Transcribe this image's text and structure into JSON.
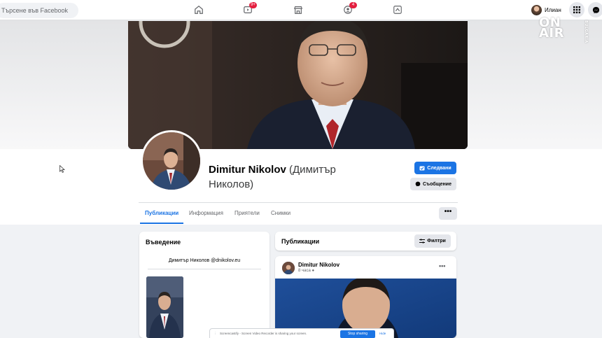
{
  "topbar": {
    "search_placeholder": "Търсене във Facebook",
    "nav_icons": [
      "home-icon",
      "watch-icon",
      "marketplace-icon",
      "groups-icon",
      "gaming-icon"
    ],
    "watch_badge": "9+",
    "groups_badge": "4",
    "user_name": "Илиан"
  },
  "watermark": {
    "text_line1": "ON",
    "text_line2": "AIR",
    "side": "BULGARIA"
  },
  "profile": {
    "name": "Dimitur Nikolov",
    "alt_name_line1": "(Димитър",
    "alt_name_line2": "Николов)",
    "follow_label": "Следвани",
    "message_label": "Съобщение"
  },
  "tabs": [
    {
      "label": "Публикации",
      "active": true
    },
    {
      "label": "Информация",
      "active": false
    },
    {
      "label": "Приятели",
      "active": false
    },
    {
      "label": "Снимки",
      "active": false
    }
  ],
  "more_label": "•••",
  "intro": {
    "title": "Въведение",
    "handle": "Димитър Николов @dnikolov.eu"
  },
  "posts": {
    "title": "Публикации",
    "filter_label": "Филтри",
    "post": {
      "author": "Dimitur Nikolov",
      "time": "8 часа",
      "more": "•••"
    }
  },
  "sharebar": {
    "text": "Screencastify - Screen Video Recorder is sharing your screen.",
    "stop_label": "Stop sharing",
    "hide_label": "Hide"
  },
  "colors": {
    "accent": "#1b74e4",
    "badge": "#e41e3f",
    "page_bg": "#f0f2f5"
  }
}
